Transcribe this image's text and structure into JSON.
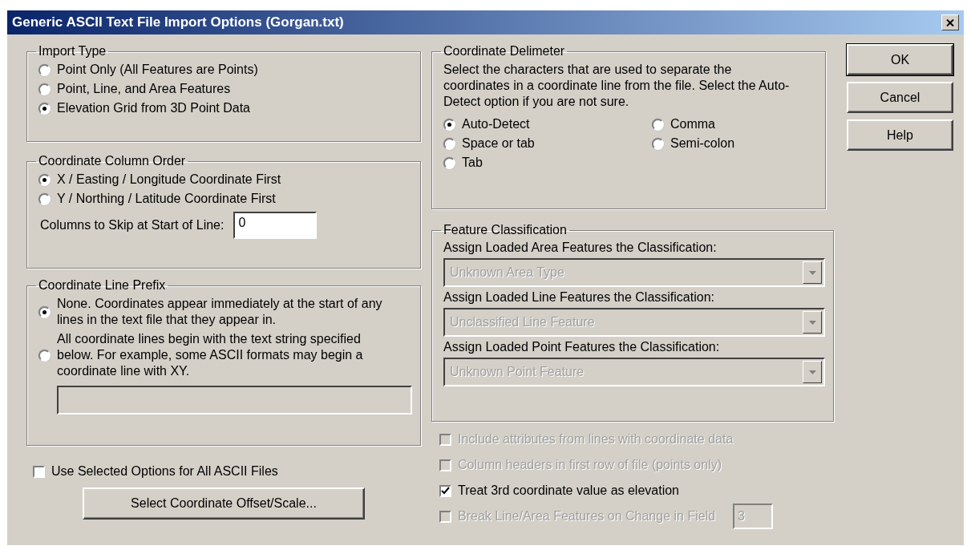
{
  "window": {
    "title": "Generic ASCII Text File Import Options (Gorgan.txt)"
  },
  "import_type": {
    "legend": "Import Type",
    "options": [
      {
        "label": "Point Only (All Features are Points)",
        "selected": false
      },
      {
        "label": "Point, Line, and Area Features",
        "selected": false
      },
      {
        "label": "Elevation Grid from 3D Point Data",
        "selected": true
      }
    ]
  },
  "column_order": {
    "legend": "Coordinate Column Order",
    "options": [
      {
        "label": "X / Easting / Longitude Coordinate First",
        "selected": true
      },
      {
        "label": "Y / Northing / Latitude Coordinate First",
        "selected": false
      }
    ],
    "skip_label": "Columns to Skip at Start of Line:",
    "skip_value": "0"
  },
  "line_prefix": {
    "legend": "Coordinate Line Prefix",
    "options": [
      {
        "label": "None. Coordinates appear immediately at the start of any lines in the text file that they appear in.",
        "selected": true
      },
      {
        "label": "All coordinate lines begin with the text string specified below. For example, some ASCII formats may begin a coordinate line with XY.",
        "selected": false
      }
    ],
    "prefix_disabled": true
  },
  "use_all": {
    "label": "Use Selected Options for All ASCII Files",
    "checked": false
  },
  "offset_button": "Select Coordinate Offset/Scale...",
  "delimiter": {
    "legend": "Coordinate Delimeter",
    "description": "Select the characters that are used to separate the coordinates in a coordinate line from the file. Select the Auto-Detect option if you are not sure.",
    "options": [
      {
        "label": "Auto-Detect",
        "selected": true
      },
      {
        "label": "Comma",
        "selected": false
      },
      {
        "label": "Space or tab",
        "selected": false
      },
      {
        "label": "Semi-colon",
        "selected": false
      },
      {
        "label": "Tab",
        "selected": false
      }
    ]
  },
  "classification": {
    "legend": "Feature Classification",
    "selects": [
      {
        "label": "Assign Loaded Area Features the Classification:",
        "value": "Unknown Area Type",
        "disabled": true
      },
      {
        "label": "Assign Loaded Line Features the Classification:",
        "value": "Unclassified Line Feature",
        "disabled": true
      },
      {
        "label": "Assign Loaded Point Features the Classification:",
        "value": "Unknown Point Feature",
        "disabled": true
      }
    ]
  },
  "options": [
    {
      "label": "Include attributes from lines with coordinate data",
      "checked": false,
      "disabled": true
    },
    {
      "label": "Column headers in first row of file (points only)",
      "checked": false,
      "disabled": true
    },
    {
      "label": "Treat 3rd coordinate value as elevation",
      "checked": true,
      "disabled": false
    },
    {
      "label": "Break Line/Area Features on Change in Field",
      "checked": false,
      "disabled": true,
      "field_value": "3"
    }
  ],
  "buttons": [
    {
      "label": "OK",
      "default": true
    },
    {
      "label": "Cancel",
      "default": false
    },
    {
      "label": "Help",
      "default": false
    }
  ]
}
